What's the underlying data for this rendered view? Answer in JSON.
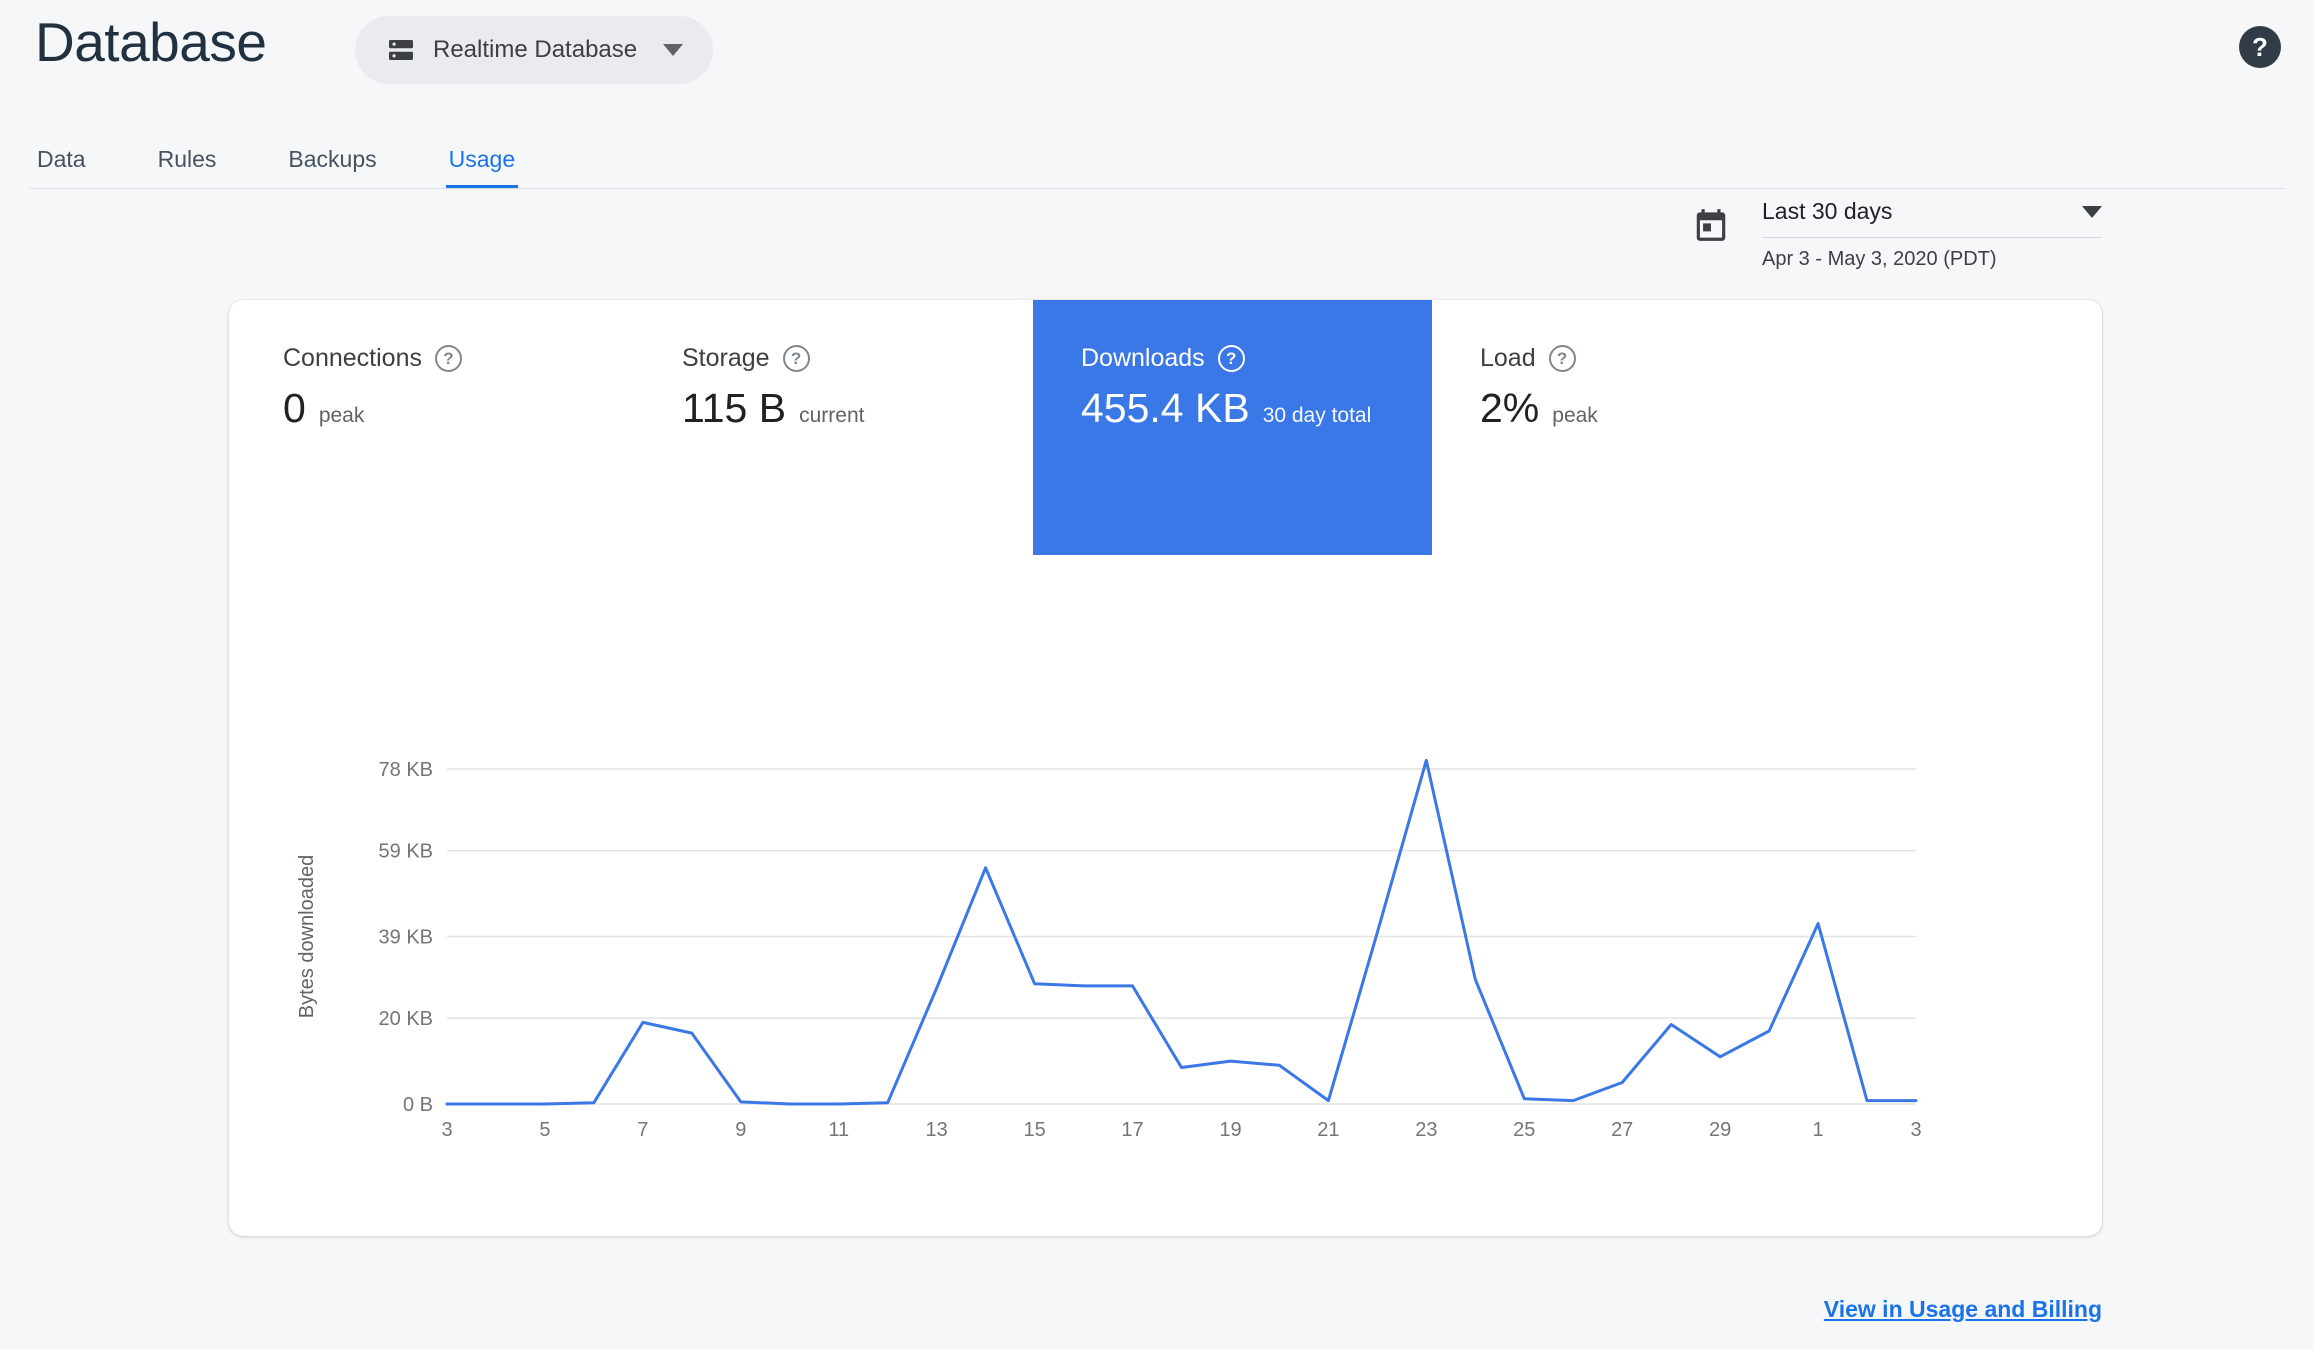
{
  "header": {
    "title": "Database",
    "db_selector_label": "Realtime Database",
    "help_glyph": "?"
  },
  "tabs": [
    {
      "label": "Data",
      "active": false
    },
    {
      "label": "Rules",
      "active": false
    },
    {
      "label": "Backups",
      "active": false
    },
    {
      "label": "Usage",
      "active": true
    }
  ],
  "date_range": {
    "label": "Last 30 days",
    "range": "Apr 3 - May 3, 2020 (PDT)"
  },
  "metrics": [
    {
      "label": "Connections",
      "value": "0",
      "unit": "peak",
      "selected": false,
      "help_glyph": "?"
    },
    {
      "label": "Storage",
      "value": "115 B",
      "unit": "current",
      "selected": false,
      "help_glyph": "?"
    },
    {
      "label": "Downloads",
      "value": "455.4 KB",
      "unit": "30 day total",
      "selected": true,
      "help_glyph": "?"
    },
    {
      "label": "Load",
      "value": "2%",
      "unit": "peak",
      "selected": false,
      "help_glyph": "?"
    }
  ],
  "footer": {
    "link_label": "View in Usage and Billing"
  },
  "colors": {
    "accent_blue": "#3b78e7",
    "link_blue": "#1a73e8",
    "grid_gray": "#e2e2e2",
    "tick_gray": "#757575"
  },
  "chart_data": {
    "type": "line",
    "ylabel": "Bytes downloaded",
    "x_start": "Apr 3, 2020",
    "x_end": "May 3, 2020",
    "x_days": [
      3,
      4,
      5,
      6,
      7,
      8,
      9,
      10,
      11,
      12,
      13,
      14,
      15,
      16,
      17,
      18,
      19,
      20,
      21,
      22,
      23,
      24,
      25,
      26,
      27,
      28,
      29,
      30,
      1,
      2,
      3
    ],
    "values_kb": [
      0,
      0,
      0,
      0.3,
      19,
      16.5,
      0.5,
      0,
      0,
      0.3,
      27,
      55,
      28,
      27.5,
      27.5,
      8.5,
      10,
      9,
      0.8,
      40,
      80,
      29,
      1.2,
      0.8,
      5,
      18.5,
      11,
      17,
      42,
      0.8,
      0.8
    ],
    "x_tick_indices": [
      0,
      2,
      4,
      6,
      8,
      10,
      12,
      14,
      16,
      18,
      20,
      22,
      24,
      26,
      28,
      30
    ],
    "x_tick_labels": [
      "3",
      "5",
      "7",
      "9",
      "11",
      "13",
      "15",
      "17",
      "19",
      "21",
      "23",
      "25",
      "27",
      "29",
      "1",
      "3"
    ],
    "y_ticks": [
      {
        "value": 0,
        "label": "0 B"
      },
      {
        "value": 20,
        "label": "20 KB"
      },
      {
        "value": 39,
        "label": "39 KB"
      },
      {
        "value": 59,
        "label": "59 KB"
      },
      {
        "value": 78,
        "label": "78 KB"
      }
    ],
    "ylim_kb": [
      0,
      82
    ],
    "line_color": "#3b78e7",
    "grid": true,
    "legend": "none"
  }
}
